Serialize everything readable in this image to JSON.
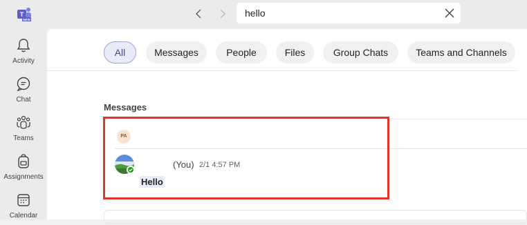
{
  "search": {
    "value": "hello"
  },
  "rail": {
    "items": [
      {
        "label": "Activity",
        "icon": "bell-icon"
      },
      {
        "label": "Chat",
        "icon": "chat-icon"
      },
      {
        "label": "Teams",
        "icon": "teams-icon"
      },
      {
        "label": "Assignments",
        "icon": "backpack-icon"
      },
      {
        "label": "Calendar",
        "icon": "calendar-icon"
      }
    ]
  },
  "filters": [
    "All",
    "Messages",
    "People",
    "Files",
    "Group Chats",
    "Teams and Channels"
  ],
  "active_filter": "All",
  "results": {
    "section_title": "Messages",
    "group_initials": "PA",
    "sender": "(You)",
    "timestamp": "2/1 4:57 PM",
    "message": "Hello"
  },
  "colors": {
    "accent": "#444791",
    "highlight_border": "#e5332a",
    "presence": "#13a10e"
  }
}
